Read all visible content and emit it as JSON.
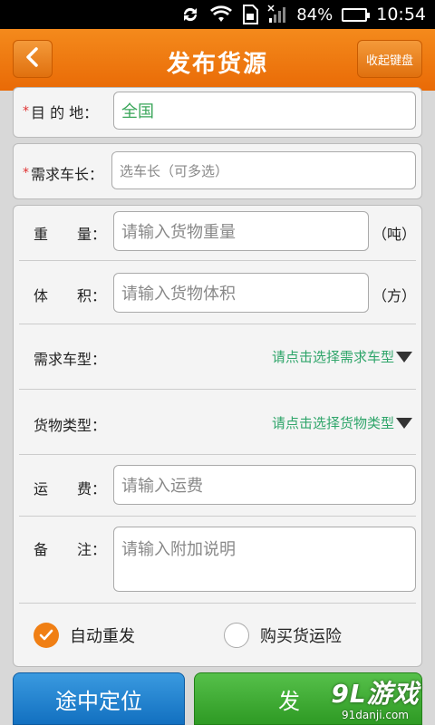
{
  "status_bar": {
    "battery": "84%",
    "time": "10:54"
  },
  "header": {
    "title": "发布货源",
    "keyboard_button": "收起键盘"
  },
  "form": {
    "destination": {
      "label": "目 的 地：",
      "value": "全国"
    },
    "truck_length": {
      "label": "需求车长：",
      "placeholder": "选车长（可多选）"
    },
    "weight": {
      "label": "重　　量：",
      "placeholder": "请输入货物重量",
      "unit": "（吨）"
    },
    "volume": {
      "label": "体　　积：",
      "placeholder": "请输入货物体积",
      "unit": "（方）"
    },
    "truck_type": {
      "label": "需求车型：",
      "picker": "请点击选择需求车型"
    },
    "cargo_type": {
      "label": "货物类型：",
      "picker": "请点击选择货物类型"
    },
    "freight": {
      "label": "运　　费：",
      "placeholder": "请输入运费"
    },
    "remarks": {
      "label": "备　　注：",
      "placeholder": "请输入附加说明"
    },
    "auto_repost": {
      "label": "自动重发",
      "checked": true
    },
    "insurance": {
      "label": "购买货运险",
      "checked": false
    }
  },
  "footer": {
    "locate_button": "途中定位",
    "publish_button": "发"
  },
  "watermark": {
    "main": "9L游戏",
    "sub": "91danji.com"
  },
  "colors": {
    "accent": "#f07f14",
    "picker_text": "#2fa56a",
    "locate": "#1e84d0",
    "publish": "#3aaa30"
  }
}
